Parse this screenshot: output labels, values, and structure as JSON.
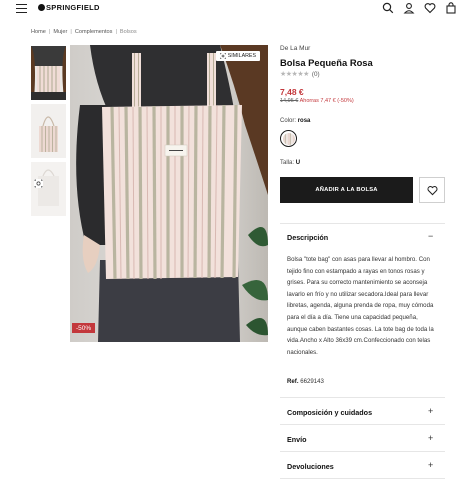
{
  "header": {
    "logo_text": "SPRINGFIELD",
    "icons": [
      "menu-icon",
      "search-icon",
      "user-icon",
      "heart-icon",
      "bag-icon"
    ]
  },
  "breadcrumb": {
    "items": [
      "Home",
      "Mujer",
      "Complementos",
      "Bolsos"
    ],
    "separator": "|"
  },
  "gallery": {
    "similares_label": "SIMILARES",
    "discount_badge": "-50%"
  },
  "product": {
    "brand": "De La Mur",
    "title": "Bolsa Pequeña Rosa",
    "review_count": "(0)",
    "rating_stars": "★★★★★",
    "price": "7,48 €",
    "old_price": "14,95 €",
    "savings": "Ahorras 7,47 € (-50%)",
    "color_label": "Color:",
    "color_value": "rosa",
    "size_label": "Talla:",
    "size_value": "U",
    "add_to_bag": "AÑADIR A LA BOLSA"
  },
  "accordion": {
    "description_title": "Descripción",
    "description_text": "Bolsa \"tote bag\" con asas para llevar al hombro. Con tejido fino con estampado a rayas en tonos rosas y grises. Para su correcto mantenimiento se aconseja lavarlo en frío y no utilizar secadora.Ideal para llevar libretas, agenda, alguna prenda de ropa, muy cómoda para el día a día. Tiene una capacidad pequeña, aunque caben bastantes cosas. La tote bag de toda la vida.Ancho x Alto 36x39 cm.Confeccionado con telas nacionales.",
    "ref_label": "Ref.",
    "ref_value": "6629143",
    "sections": [
      {
        "title": "Composición y cuidados",
        "sign": "+"
      },
      {
        "title": "Envío",
        "sign": "+"
      },
      {
        "title": "Devoluciones",
        "sign": "+"
      }
    ],
    "collapse_sign": "−"
  },
  "colors": {
    "accent": "#c3373b",
    "button": "#1b1b1b"
  }
}
